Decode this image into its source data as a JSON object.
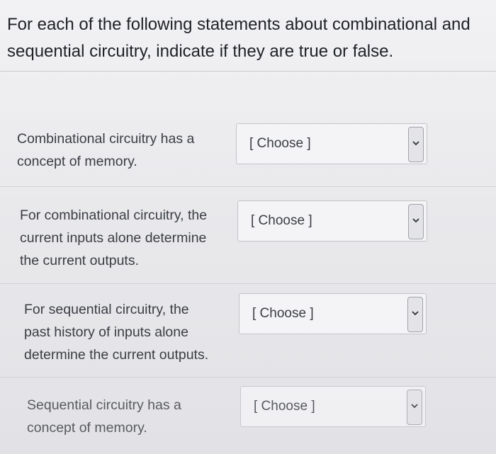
{
  "question": {
    "lines": [
      "For each of the following statements about combinational and",
      "sequential circuitry, indicate if they are true or false."
    ]
  },
  "items": [
    {
      "prompt_lines": [
        "Combinational circuitry has a",
        "concept of memory."
      ],
      "select_value": "[ Choose ]",
      "arrow_icon": "chevron-down-icon"
    },
    {
      "prompt_lines": [
        "For combinational circuitry, the",
        "current inputs alone determine",
        "the current outputs."
      ],
      "select_value": "[ Choose ]",
      "arrow_icon": "chevron-down-icon"
    },
    {
      "prompt_lines": [
        "For sequential circuitry, the",
        "past history of inputs alone",
        "determine the current outputs."
      ],
      "select_value": "[ Choose ]",
      "arrow_icon": "chevron-down-icon"
    },
    {
      "prompt_lines": [
        "Sequential circuitry has a",
        "concept of memory."
      ],
      "select_value": "[ Choose ]",
      "arrow_icon": "chevron-down-icon"
    }
  ],
  "colors": {
    "text": "#2e3135",
    "background": "#e9e9ec",
    "border": "#c4c4c8"
  }
}
